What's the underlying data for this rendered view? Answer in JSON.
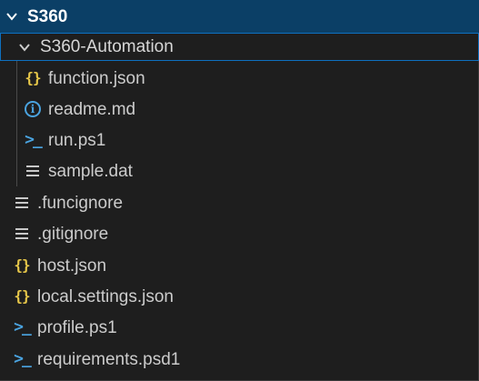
{
  "root": {
    "label": "S360",
    "expanded": true
  },
  "folder": {
    "label": "S360-Automation",
    "expanded": true,
    "children": [
      {
        "label": "function.json",
        "icon": "json-icon"
      },
      {
        "label": "readme.md",
        "icon": "info-icon"
      },
      {
        "label": "run.ps1",
        "icon": "powershell-icon"
      },
      {
        "label": "sample.dat",
        "icon": "text-lines-icon"
      }
    ]
  },
  "files": [
    {
      "label": ".funcignore",
      "icon": "text-lines-icon"
    },
    {
      "label": ".gitignore",
      "icon": "text-lines-icon"
    },
    {
      "label": "host.json",
      "icon": "json-icon"
    },
    {
      "label": "local.settings.json",
      "icon": "json-icon"
    },
    {
      "label": "profile.ps1",
      "icon": "powershell-icon"
    },
    {
      "label": "requirements.psd1",
      "icon": "powershell-icon"
    }
  ],
  "colors": {
    "background": "#1e1e1e",
    "root_highlight": "#0b3f66",
    "folder_focus_border": "#0e70c0",
    "json_icon": "#e8c84a",
    "info_icon": "#4aa3df",
    "powershell_icon": "#4aa3df"
  }
}
